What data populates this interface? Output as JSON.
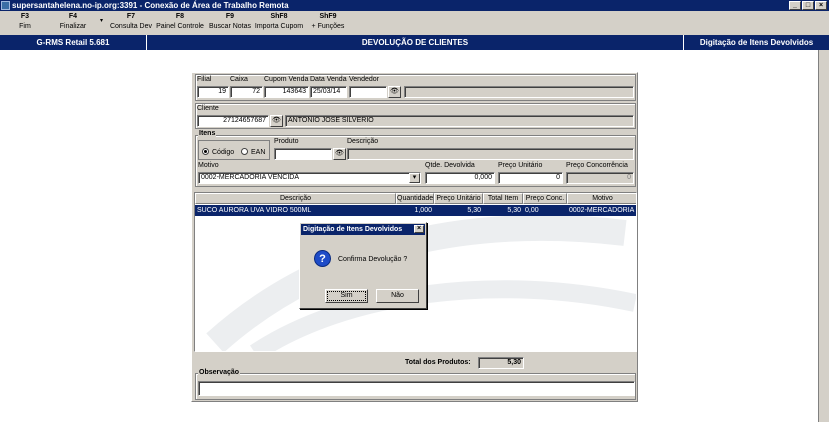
{
  "window": {
    "title": "supersantahelena.no-ip.org:3391 - Conexão de Área de Trabalho Remota",
    "minimize": "_",
    "maximize": "□",
    "close": "×"
  },
  "fkeys": [
    {
      "key": "F3",
      "label": "Fim"
    },
    {
      "key": "F4",
      "label": "Finalizar"
    },
    {
      "key": "F7",
      "label": "Consulta Dev"
    },
    {
      "key": "F8",
      "label": "Painel Controle"
    },
    {
      "key": "F9",
      "label": "Buscar Notas"
    },
    {
      "key": "ShF8",
      "label": "Importa Cupom"
    },
    {
      "key": "ShF9",
      "label": "+ Funções"
    }
  ],
  "header": {
    "app": "G-RMS Retail 5.681",
    "screen": "DEVOLUÇÃO DE CLIENTES",
    "context": "Digitação de Itens Devolvidos"
  },
  "form": {
    "filial_label": "Filial",
    "filial": "19",
    "caixa_label": "Caixa",
    "caixa": "72",
    "cupom_label": "Cupom Venda",
    "cupom": "143643",
    "data_label": "Data Venda",
    "data": "25/03/14",
    "vendedor_label": "Vendedor",
    "vendedor": "",
    "cliente_label": "Cliente",
    "cliente_code": "27124657687",
    "cliente_name": "ANTONIO JOSE SILVERIO",
    "itens_label": "Itens",
    "codigo_label": "Código",
    "ean_label": "EAN",
    "produto_label": "Produto",
    "produto": "",
    "descricao_label": "Descrição",
    "descricao": "",
    "motivo_label": "Motivo",
    "motivo": "0002-MERCADORIA VENCIDA",
    "qtde_label": "Qtde. Devolvida",
    "qtde": "0,000",
    "preco_unit_label": "Preço Unitário",
    "preco_unit": "0",
    "preco_conc_label": "Preço Concorrência",
    "preco_conc": "0",
    "total_label": "Total dos Produtos:",
    "total": "5,30",
    "obs_label": "Observação",
    "obs": ""
  },
  "grid": {
    "headers": [
      "Descrição",
      "Quantidade",
      "Preço Unitário",
      "Total Item",
      "Preço Conc.",
      "Motivo"
    ],
    "rows": [
      [
        "SUCO AURORA UVA VIDRO 500ML",
        "1,000",
        "5,30",
        "5,30",
        "0,00",
        "0002-MERCADORIA VE"
      ]
    ]
  },
  "dialog": {
    "title": "Digitação de Itens Devolvidos",
    "message": "Confirma Devolução ?",
    "yes": "Sim",
    "no": "Não"
  }
}
